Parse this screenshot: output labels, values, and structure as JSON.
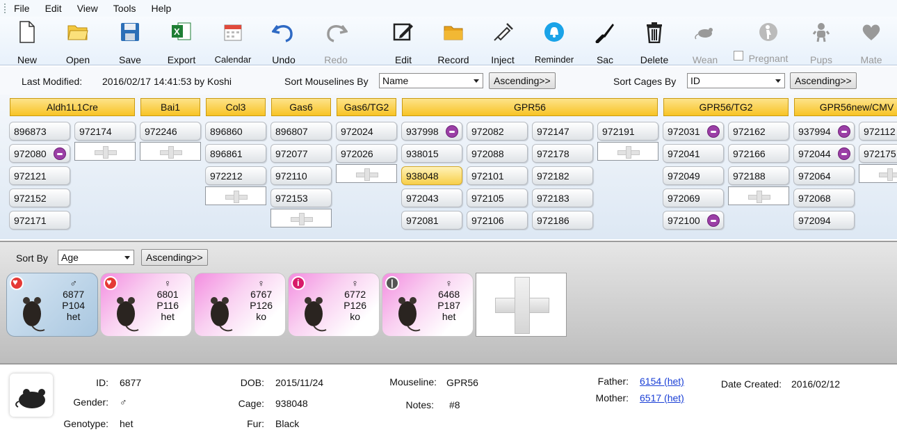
{
  "menu": [
    "File",
    "Edit",
    "View",
    "Tools",
    "Help"
  ],
  "toolbar": [
    {
      "label": "New",
      "icon": "new-file-icon"
    },
    {
      "label": "Open",
      "icon": "open-folder-icon"
    },
    {
      "label": "Save",
      "icon": "save-floppy-icon"
    },
    {
      "label": "Export",
      "icon": "excel-export-icon"
    },
    {
      "label": "Calendar",
      "icon": "calendar-icon"
    },
    {
      "label": "Undo",
      "icon": "undo-arrow-icon"
    },
    {
      "label": "Redo",
      "icon": "redo-arrow-icon"
    },
    {
      "label": "Edit",
      "icon": "edit-pen-icon"
    },
    {
      "label": "Record",
      "icon": "record-folder-icon"
    },
    {
      "label": "Inject",
      "icon": "syringe-icon"
    },
    {
      "label": "Reminder",
      "icon": "bell-icon"
    },
    {
      "label": "Sac",
      "icon": "knife-icon"
    },
    {
      "label": "Delete",
      "icon": "trash-icon"
    },
    {
      "label": "Wean",
      "icon": "mouse-icon"
    },
    {
      "label": "Pregnant",
      "icon": "pregnant-icon"
    },
    {
      "label": "Pups",
      "icon": "baby-icon"
    },
    {
      "label": "Mate",
      "icon": "heart-icon"
    }
  ],
  "filter": {
    "last_modified_label": "Last Modified:",
    "last_modified_value": "2016/02/17 14:41:53 by Koshi",
    "sort_mouselines_label": "Sort Mouselines By",
    "sort_mouselines_value": "Name",
    "sort_mouselines_order": "Ascending>>",
    "sort_cages_label": "Sort Cages By",
    "sort_cages_value": "ID",
    "sort_cages_order": "Ascending>>"
  },
  "mouselines": [
    {
      "name": "Aldh1L1Cre",
      "columns": [
        [
          "896873",
          "972080",
          "972121",
          "972152",
          "972171"
        ],
        [
          "972174",
          "+"
        ]
      ]
    },
    {
      "name": "Bai1",
      "columns": [
        [
          "972246",
          "+"
        ]
      ]
    },
    {
      "name": "Col3",
      "columns": [
        [
          "896860",
          "896861",
          "972212",
          "+"
        ]
      ]
    },
    {
      "name": "Gas6",
      "columns": [
        [
          "896807",
          "972077",
          "972110",
          "972153",
          "+"
        ]
      ]
    },
    {
      "name": "Gas6/TG2",
      "columns": [
        [
          "972024",
          "972026",
          "+"
        ]
      ]
    },
    {
      "name": "GPR56",
      "columns": [
        [
          "937998",
          "938015",
          "938048",
          "972043",
          "972081"
        ],
        [
          "972082",
          "972088",
          "972101",
          "972105",
          "972106"
        ],
        [
          "972147",
          "972178",
          "972182",
          "972183",
          "972186"
        ],
        [
          "972191",
          "+"
        ]
      ]
    },
    {
      "name": "GPR56/TG2",
      "columns": [
        [
          "972031",
          "972041",
          "972049",
          "972069",
          "972100"
        ],
        [
          "972162",
          "972166",
          "972188",
          "+"
        ]
      ]
    },
    {
      "name": "GPR56new/CMV",
      "columns": [
        [
          "937994",
          "972044",
          "972064",
          "972068",
          "972094"
        ],
        [
          "972112",
          "972175",
          "+"
        ]
      ]
    }
  ],
  "badged_cages": [
    "972080",
    "937998",
    "972031",
    "972100",
    "937994",
    "972044"
  ],
  "selected_cage": "938048",
  "mouse_strip": {
    "sort_by_label": "Sort By",
    "sort_by_value": "Age",
    "sort_order": "Ascending>>",
    "mice": [
      {
        "gender": "♂",
        "id": "6877",
        "age": "P104",
        "genotype": "het",
        "status": "mate-heart-icon",
        "sex": "m"
      },
      {
        "gender": "♀",
        "id": "6801",
        "age": "P116",
        "genotype": "het",
        "status": "mate-heart-icon",
        "sex": "f"
      },
      {
        "gender": "♀",
        "id": "6767",
        "age": "P126",
        "genotype": "ko",
        "status": "",
        "sex": "f"
      },
      {
        "gender": "♀",
        "id": "6772",
        "age": "P126",
        "genotype": "ko",
        "status": "pregnant-icon",
        "sex": "f"
      },
      {
        "gender": "♀",
        "id": "6468",
        "age": "P187",
        "genotype": "het",
        "status": "elderly-icon",
        "sex": "f"
      }
    ]
  },
  "detail": {
    "id_label": "ID:",
    "id": "6877",
    "gender_label": "Gender:",
    "gender": "♂",
    "genotype_label": "Genotype:",
    "genotype": "het",
    "dob_label": "DOB:",
    "dob": "2015/11/24",
    "cage_label": "Cage:",
    "cage": "938048",
    "fur_label": "Fur:",
    "fur": "Black",
    "mouseline_label": "Mouseline:",
    "mouseline": "GPR56",
    "notes_label": "Notes:",
    "notes": "#8",
    "father_label": "Father:",
    "father": "6154 (het)",
    "mother_label": "Mother:",
    "mother": "6517 (het)",
    "created_label": "Date Created:",
    "created": "2016/02/12"
  }
}
